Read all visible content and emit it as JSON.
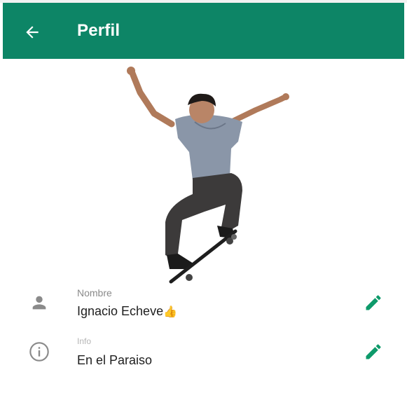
{
  "toolbar": {
    "title": "Perfil",
    "back_icon": "arrow-left-icon",
    "background_color": "#0d8566"
  },
  "profile": {
    "photo_icon": "skateboarder-photo",
    "name_row": {
      "label": "Nombre",
      "value": "Ignacio Echeve",
      "value_emoji": "👍",
      "icon": "person-icon",
      "edit_icon": "pencil-icon"
    },
    "info_row": {
      "label": "Info",
      "value": "En el Paraiso",
      "icon": "info-icon",
      "edit_icon": "pencil-icon"
    },
    "accent_color": "#0d9a6a"
  }
}
